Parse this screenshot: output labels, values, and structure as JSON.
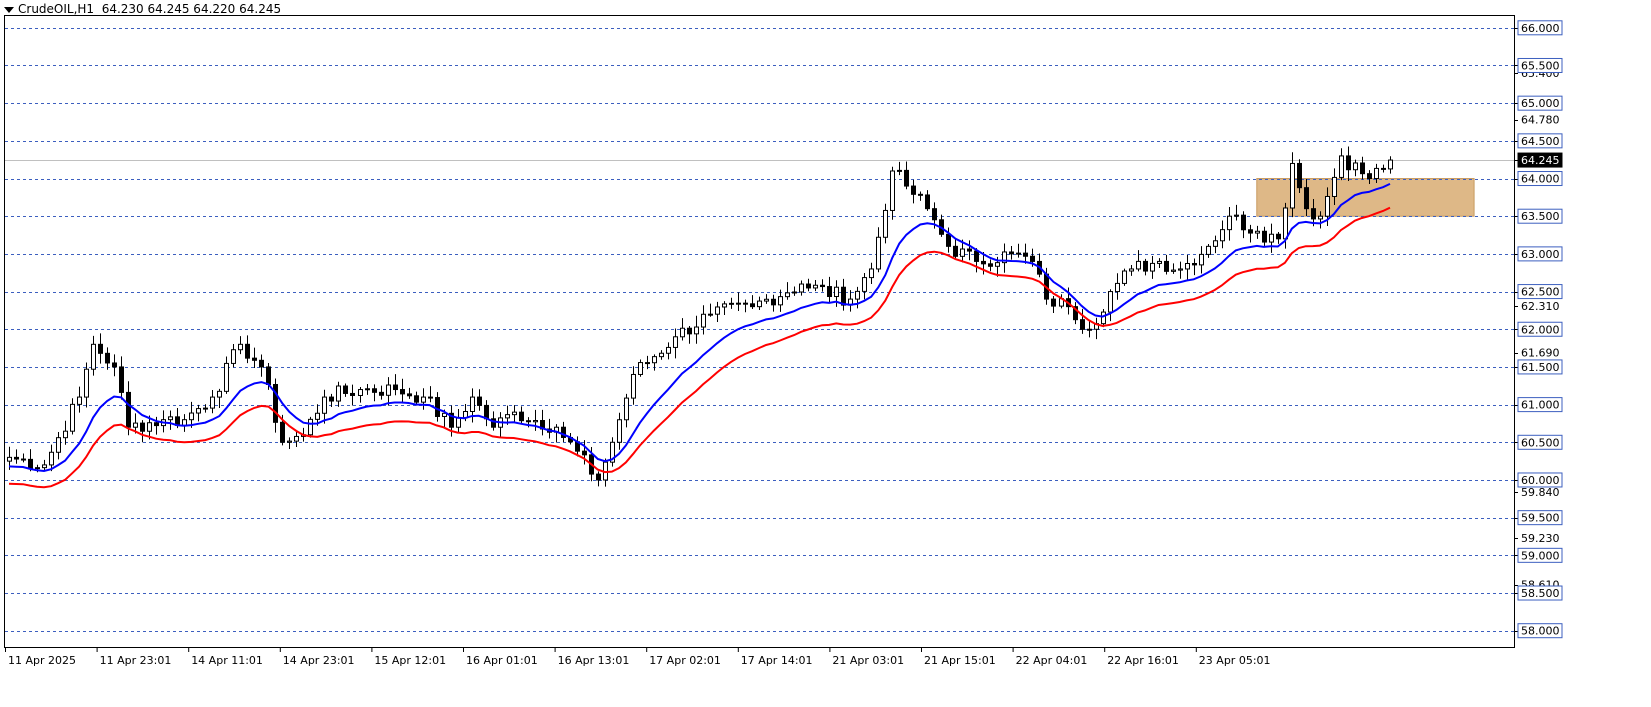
{
  "header": {
    "symbol": "CrudeOIL,H1",
    "ohlc": "64.230 64.245 64.220 64.245"
  },
  "chart_data": {
    "type": "candlestick",
    "ylim": [
      57.7,
      66.2
    ],
    "grid_levels": [
      66.0,
      65.5,
      65.0,
      64.5,
      64.0,
      63.5,
      63.0,
      62.5,
      62.0,
      61.5,
      61.0,
      60.5,
      60.0,
      59.5,
      59.0,
      58.5,
      58.0
    ],
    "grid_labels": [
      "66.000",
      "65.500",
      "65.000",
      "64.500",
      "64.000",
      "63.500",
      "63.000",
      "62.500",
      "62.000",
      "61.500",
      "61.000",
      "60.500",
      "60.000",
      "59.500",
      "59.000",
      "58.500",
      "58.000"
    ],
    "extra_ticks": [
      {
        "value": 65.4,
        "label": "65.400"
      },
      {
        "value": 64.78,
        "label": "64.780"
      },
      {
        "value": 62.31,
        "label": "62.310"
      },
      {
        "value": 61.69,
        "label": "61.690"
      },
      {
        "value": 59.84,
        "label": "59.840"
      },
      {
        "value": 59.23,
        "label": "59.230"
      },
      {
        "value": 58.61,
        "label": "58.610"
      }
    ],
    "current_price": {
      "value": 64.245,
      "label": "64.245"
    },
    "time_labels": [
      "11 Apr 2025",
      "11 Apr 23:01",
      "14 Apr 11:01",
      "14 Apr 23:01",
      "15 Apr 12:01",
      "16 Apr 01:01",
      "16 Apr 13:01",
      "17 Apr 02:01",
      "17 Apr 14:01",
      "21 Apr 03:01",
      "21 Apr 15:01",
      "22 Apr 04:01",
      "22 Apr 16:01",
      "23 Apr 05:01"
    ],
    "zone": {
      "low": 63.5,
      "high": 64.0,
      "start_index": 178,
      "end_index": 209,
      "color": "#deb887"
    },
    "ma_colors": {
      "fast": "#0000ff",
      "slow": "#ff0000"
    },
    "candle_colors": {
      "up": "#ffffff",
      "down": "#000000",
      "outline": "#000000"
    },
    "anchors": [
      {
        "i": 0,
        "p": 60.3
      },
      {
        "i": 5,
        "p": 60.2
      },
      {
        "i": 10,
        "p": 61.1
      },
      {
        "i": 12,
        "p": 61.8
      },
      {
        "i": 15,
        "p": 61.5
      },
      {
        "i": 17,
        "p": 60.7
      },
      {
        "i": 22,
        "p": 60.8
      },
      {
        "i": 25,
        "p": 60.8
      },
      {
        "i": 29,
        "p": 61.1
      },
      {
        "i": 33,
        "p": 61.8
      },
      {
        "i": 36,
        "p": 61.5
      },
      {
        "i": 39,
        "p": 60.5
      },
      {
        "i": 42,
        "p": 60.6
      },
      {
        "i": 45,
        "p": 61.1
      },
      {
        "i": 50,
        "p": 61.2
      },
      {
        "i": 55,
        "p": 61.2
      },
      {
        "i": 59,
        "p": 61.1
      },
      {
        "i": 63,
        "p": 60.7
      },
      {
        "i": 66,
        "p": 61.1
      },
      {
        "i": 69,
        "p": 60.7
      },
      {
        "i": 72,
        "p": 60.9
      },
      {
        "i": 78,
        "p": 60.7
      },
      {
        "i": 84,
        "p": 60.0
      },
      {
        "i": 86,
        "p": 60.5
      },
      {
        "i": 89,
        "p": 61.4
      },
      {
        "i": 95,
        "p": 61.9
      },
      {
        "i": 100,
        "p": 62.2
      },
      {
        "i": 106,
        "p": 62.3
      },
      {
        "i": 113,
        "p": 62.6
      },
      {
        "i": 120,
        "p": 62.4
      },
      {
        "i": 123,
        "p": 62.8
      },
      {
        "i": 126,
        "p": 64.1
      },
      {
        "i": 128,
        "p": 63.9
      },
      {
        "i": 131,
        "p": 63.6
      },
      {
        "i": 134,
        "p": 63.1
      },
      {
        "i": 138,
        "p": 62.9
      },
      {
        "i": 143,
        "p": 63.0
      },
      {
        "i": 146,
        "p": 62.9
      },
      {
        "i": 148,
        "p": 62.4
      },
      {
        "i": 151,
        "p": 62.3
      },
      {
        "i": 154,
        "p": 62.0
      },
      {
        "i": 157,
        "p": 62.5
      },
      {
        "i": 160,
        "p": 62.8
      },
      {
        "i": 164,
        "p": 62.9
      },
      {
        "i": 167,
        "p": 62.8
      },
      {
        "i": 171,
        "p": 63.1
      },
      {
        "i": 174,
        "p": 63.5
      },
      {
        "i": 178,
        "p": 63.3
      },
      {
        "i": 181,
        "p": 63.2
      },
      {
        "i": 183,
        "p": 64.2
      },
      {
        "i": 185,
        "p": 63.6
      },
      {
        "i": 187,
        "p": 63.5
      },
      {
        "i": 190,
        "p": 64.3
      },
      {
        "i": 194,
        "p": 64.0
      },
      {
        "i": 197,
        "p": 64.245
      }
    ]
  }
}
